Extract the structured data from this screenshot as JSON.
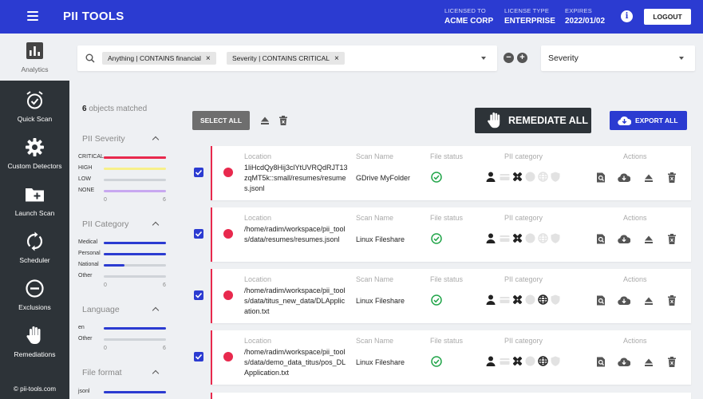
{
  "header": {
    "logo": "PII TOOLS",
    "licensed_to_label": "LICENSED TO",
    "licensed_to_value": "ACME CORP",
    "license_type_label": "LICENSE TYPE",
    "license_type_value": "ENTERPRISE",
    "expires_label": "EXPIRES",
    "expires_value": "2022/01/02",
    "logout_label": "LOGOUT"
  },
  "sidebar": {
    "items": [
      {
        "label": "Analytics",
        "icon": "analytics-icon"
      },
      {
        "label": "Quick Scan",
        "icon": "alarm-clock-icon"
      },
      {
        "label": "Custom Detectors",
        "icon": "gear-icon"
      },
      {
        "label": "Launch Scan",
        "icon": "folder-plus-icon"
      },
      {
        "label": "Scheduler",
        "icon": "sync-icon"
      },
      {
        "label": "Exclusions",
        "icon": "minus-circle-icon"
      },
      {
        "label": "Remediations",
        "icon": "hand-icon"
      }
    ],
    "copyright": "© pii-tools.com"
  },
  "search": {
    "chips": [
      {
        "label": "Anything | CONTAINS financial"
      },
      {
        "label": "Severity | CONTAINS CRITICAL"
      }
    ],
    "remove_glyph": "×"
  },
  "sort": {
    "value": "Severity"
  },
  "filters": {
    "matched_count": "6",
    "matched_text": "objects matched",
    "severity": {
      "title": "PII Severity",
      "rows": [
        {
          "label": "CRITICAL",
          "fraction": 1.0,
          "color": "#e8294d",
          "track": "#e8294d"
        },
        {
          "label": "HIGH",
          "fraction": 0.0,
          "color": "#f7f08a",
          "track": "#f7f08a"
        },
        {
          "label": "LOW",
          "fraction": 0.0,
          "color": "#cfd3d8",
          "track": "#cfd3d8"
        },
        {
          "label": "NONE",
          "fraction": 0.0,
          "color": "#c8a8f0",
          "track": "#c8a8f0"
        }
      ],
      "scale_min": "0",
      "scale_max": "6"
    },
    "category": {
      "title": "PII Category",
      "rows": [
        {
          "label": "Medical",
          "fraction": 1.0,
          "color": "#2b3bd1",
          "track": "#cfd3d8"
        },
        {
          "label": "Personal",
          "fraction": 1.0,
          "color": "#2b3bd1",
          "track": "#cfd3d8"
        },
        {
          "label": "National",
          "fraction": 0.33,
          "color": "#2b3bd1",
          "track": "#cfd3d8"
        },
        {
          "label": "Other",
          "fraction": 0.0,
          "color": "#2b3bd1",
          "track": "#cfd3d8"
        }
      ],
      "scale_min": "0",
      "scale_max": "6"
    },
    "language": {
      "title": "Language",
      "rows": [
        {
          "label": "en",
          "fraction": 1.0,
          "color": "#2b3bd1",
          "track": "#cfd3d8"
        },
        {
          "label": "Other",
          "fraction": 0.0,
          "color": "#2b3bd1",
          "track": "#cfd3d8"
        }
      ],
      "scale_min": "0",
      "scale_max": "6"
    },
    "file_format": {
      "title": "File format",
      "rows": [
        {
          "label": "jsonl",
          "fraction": 1.0,
          "color": "#2b3bd1",
          "track": "#cfd3d8"
        }
      ]
    }
  },
  "toolbar": {
    "select_all_label": "SELECT ALL",
    "remediate_all_label": "REMEDIATE ALL",
    "export_all_label": "EXPORT ALL"
  },
  "columns": {
    "location": "Location",
    "scan_name": "Scan Name",
    "file_status": "File status",
    "pii_category": "PII category",
    "actions": "Actions"
  },
  "rows": [
    {
      "location": "1liHcdQy8Hij3clYtUVRQdRJT13zqMT5k::small/resumes/resumes.jsonl",
      "scan_name": "GDrive MyFolder",
      "pii_active": [
        true,
        false,
        true,
        false,
        false,
        false
      ]
    },
    {
      "location": "/home/radim/workspace/pii_tools/data/resumes/resumes.jsonl",
      "scan_name": "Linux Fileshare",
      "pii_active": [
        true,
        false,
        true,
        false,
        false,
        false
      ]
    },
    {
      "location": "/home/radim/workspace/pii_tools/data/titus_new_data/DLApplication.txt",
      "scan_name": "Linux Fileshare",
      "pii_active": [
        true,
        false,
        true,
        false,
        true,
        false
      ]
    },
    {
      "location": "/home/radim/workspace/pii_tools/data/demo_data_titus/pos_DLApplication.txt",
      "scan_name": "Linux Fileshare",
      "pii_active": [
        true,
        false,
        true,
        false,
        true,
        false
      ]
    }
  ]
}
